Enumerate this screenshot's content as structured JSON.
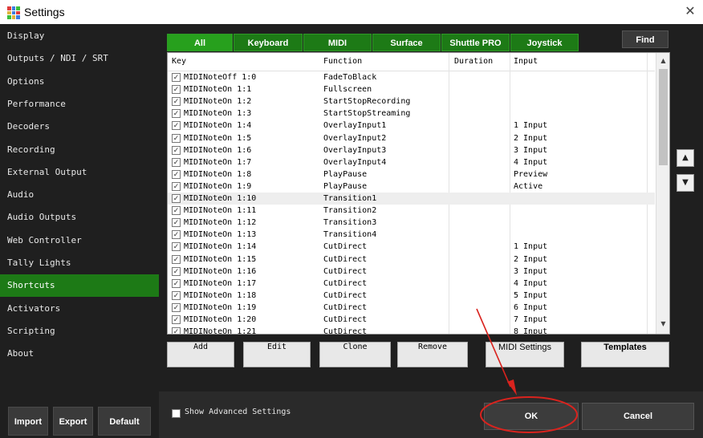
{
  "window": {
    "title": "Settings",
    "close_glyph": "✕",
    "icon_colors": [
      "#e03b3b",
      "#3b7de0",
      "#3bbf3b",
      "#e0b43b",
      "#3b7de0",
      "#e03b3b",
      "#3bbf3b",
      "#e0b43b",
      "#3b7de0"
    ]
  },
  "sidebar": {
    "items": [
      {
        "label": "Display"
      },
      {
        "label": "Outputs / NDI / SRT"
      },
      {
        "label": "Options"
      },
      {
        "label": "Performance"
      },
      {
        "label": "Decoders"
      },
      {
        "label": "Recording"
      },
      {
        "label": "External Output"
      },
      {
        "label": "Audio"
      },
      {
        "label": "Audio Outputs"
      },
      {
        "label": "Web Controller"
      },
      {
        "label": "Tally Lights"
      },
      {
        "label": "Shortcuts",
        "active": true
      },
      {
        "label": "Activators"
      },
      {
        "label": "Scripting"
      },
      {
        "label": "About"
      }
    ],
    "buttons": {
      "import": "Import",
      "export": "Export",
      "default": "Default"
    }
  },
  "tabs": [
    "All",
    "Keyboard",
    "MIDI",
    "Surface",
    "Shuttle PRO",
    "Joystick"
  ],
  "active_tab": "All",
  "find_label": "Find",
  "table": {
    "columns": {
      "key": "Key",
      "function": "Function",
      "duration": "Duration",
      "input": "Input"
    },
    "rows": [
      {
        "key": "MIDINoteOff 1:0",
        "function": "FadeToBlack",
        "input": ""
      },
      {
        "key": "MIDINoteOn 1:1",
        "function": "Fullscreen",
        "input": ""
      },
      {
        "key": "MIDINoteOn 1:2",
        "function": "StartStopRecording",
        "input": ""
      },
      {
        "key": "MIDINoteOn 1:3",
        "function": "StartStopStreaming",
        "input": ""
      },
      {
        "key": "MIDINoteOn 1:4",
        "function": "OverlayInput1",
        "input": "1 Input"
      },
      {
        "key": "MIDINoteOn 1:5",
        "function": "OverlayInput2",
        "input": "2 Input"
      },
      {
        "key": "MIDINoteOn 1:6",
        "function": "OverlayInput3",
        "input": "3 Input"
      },
      {
        "key": "MIDINoteOn 1:7",
        "function": "OverlayInput4",
        "input": "4 Input"
      },
      {
        "key": "MIDINoteOn 1:8",
        "function": "PlayPause",
        "input": "Preview"
      },
      {
        "key": "MIDINoteOn 1:9",
        "function": "PlayPause",
        "input": "Active"
      },
      {
        "key": "MIDINoteOn 1:10",
        "function": "Transition1",
        "input": "",
        "highlight": true
      },
      {
        "key": "MIDINoteOn 1:11",
        "function": "Transition2",
        "input": ""
      },
      {
        "key": "MIDINoteOn 1:12",
        "function": "Transition3",
        "input": ""
      },
      {
        "key": "MIDINoteOn 1:13",
        "function": "Transition4",
        "input": ""
      },
      {
        "key": "MIDINoteOn 1:14",
        "function": "CutDirect",
        "input": "1 Input"
      },
      {
        "key": "MIDINoteOn 1:15",
        "function": "CutDirect",
        "input": "2 Input"
      },
      {
        "key": "MIDINoteOn 1:16",
        "function": "CutDirect",
        "input": "3 Input"
      },
      {
        "key": "MIDINoteOn 1:17",
        "function": "CutDirect",
        "input": "4 Input"
      },
      {
        "key": "MIDINoteOn 1:18",
        "function": "CutDirect",
        "input": "5 Input"
      },
      {
        "key": "MIDINoteOn 1:19",
        "function": "CutDirect",
        "input": "6 Input"
      },
      {
        "key": "MIDINoteOn 1:20",
        "function": "CutDirect",
        "input": "7 Input"
      },
      {
        "key": "MIDINoteOn 1:21",
        "function": "CutDirect",
        "input": "8 Input"
      }
    ],
    "check_glyph": "✓",
    "scroll_up": "▲",
    "scroll_down": "▼"
  },
  "move_up": "▲",
  "move_down": "▼",
  "actions": {
    "add": "Add",
    "edit": "Edit",
    "clone": "Clone",
    "remove": "Remove",
    "midi_settings": "MIDI Settings",
    "templates": "Templates"
  },
  "footer": {
    "show_advanced": "Show Advanced Settings",
    "ok": "OK",
    "cancel": "Cancel"
  },
  "annotation_color": "#d9231e"
}
